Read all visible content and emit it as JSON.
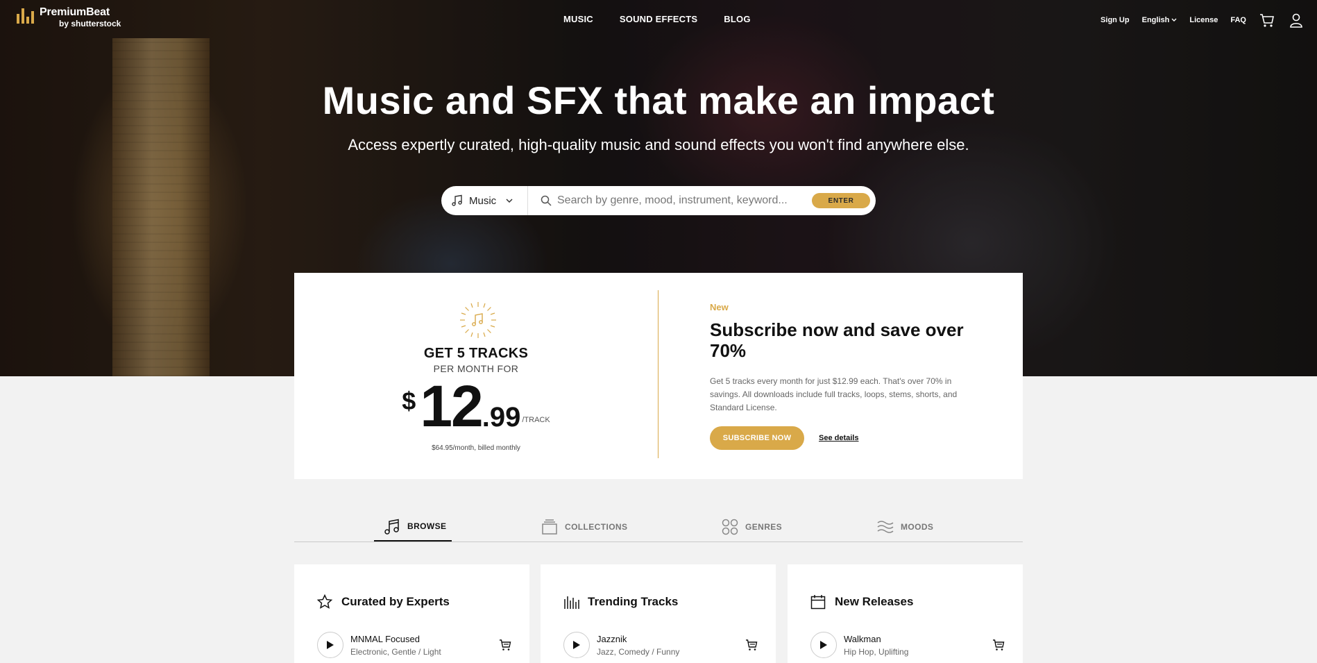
{
  "brand": {
    "name": "PremiumBeat",
    "byline": "by shutterstock",
    "accent": "#d9a949"
  },
  "nav": {
    "main": [
      "MUSIC",
      "SOUND EFFECTS",
      "BLOG"
    ],
    "signup": "Sign Up",
    "language": "English",
    "license": "License",
    "faq": "FAQ"
  },
  "hero": {
    "title": "Music and SFX that make an impact",
    "subtitle": "Access expertly curated, high-quality music and sound effects you won't find anywhere else."
  },
  "search": {
    "type_selected": "Music",
    "placeholder": "Search by genre, mood, instrument, keyword...",
    "enter_label": "ENTER"
  },
  "promo": {
    "get": "GET 5 TRACKS",
    "per_month": "PER MONTH FOR",
    "currency": "$",
    "price_whole": "12",
    "price_cents": ".99",
    "unit": "/TRACK",
    "billed": "$64.95/month, billed monthly",
    "badge": "New",
    "headline": "Subscribe now and save over 70%",
    "description": "Get 5 tracks every month for just $12.99 each. That's over 70% in savings. All downloads include full tracks, loops, stems, shorts, and Standard License.",
    "subscribe_label": "SUBSCRIBE NOW",
    "details_label": "See details"
  },
  "tabs": [
    {
      "label": "BROWSE",
      "icon": "music-note-icon",
      "active": true
    },
    {
      "label": "COLLECTIONS",
      "icon": "collections-icon",
      "active": false
    },
    {
      "label": "GENRES",
      "icon": "genres-icon",
      "active": false
    },
    {
      "label": "MOODS",
      "icon": "moods-icon",
      "active": false
    }
  ],
  "cards": [
    {
      "title": "Curated by Experts",
      "icon": "star-icon",
      "track": "MNMAL Focused",
      "tags": "Electronic, Gentle / Light"
    },
    {
      "title": "Trending Tracks",
      "icon": "bars-icon",
      "track": "Jazznik",
      "tags": "Jazz, Comedy / Funny"
    },
    {
      "title": "New Releases",
      "icon": "calendar-icon",
      "track": "Walkman",
      "tags": "Hip Hop, Uplifting"
    }
  ]
}
